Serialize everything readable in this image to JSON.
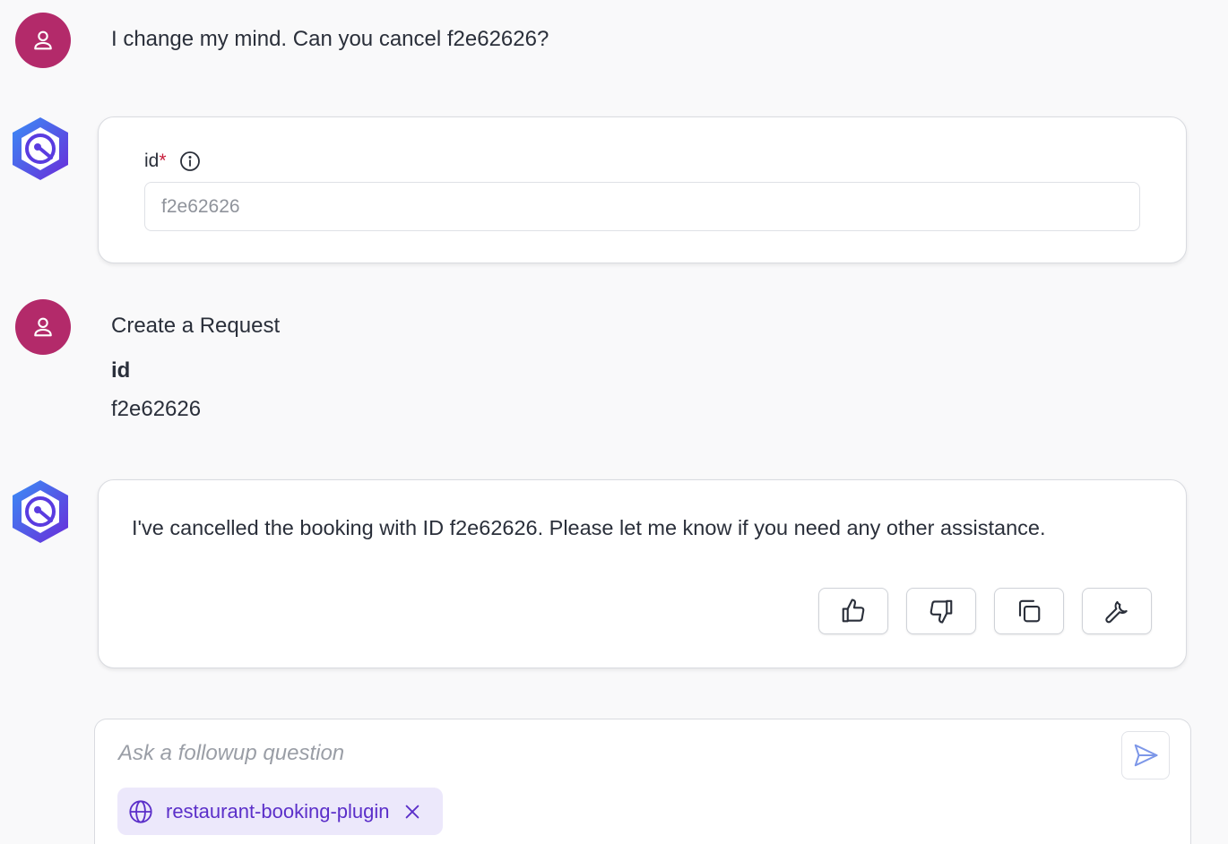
{
  "messages": [
    {
      "role": "user",
      "text": "I change my mind. Can you cancel f2e62626?"
    },
    {
      "role": "assistant",
      "form": {
        "field_label": "id",
        "required_mark": "*",
        "field_value": "f2e62626"
      }
    },
    {
      "role": "user",
      "title": "Create a Request",
      "param_name": "id",
      "param_value": "f2e62626"
    },
    {
      "role": "assistant",
      "text": "I've cancelled the booking with ID f2e62626. Please let me know if you need any other assistance.",
      "actions": [
        "thumbs-up-icon",
        "thumbs-down-icon",
        "copy-icon",
        "wrench-icon"
      ]
    }
  ],
  "composer": {
    "placeholder": "Ask a followup question",
    "plugin_chip": {
      "label": "restaurant-booking-plugin",
      "icon": "globe-icon"
    }
  },
  "colors": {
    "user_avatar": "#b32a6a",
    "bot_gradient_start": "#3a8ef6",
    "bot_gradient_end": "#6a2bd9",
    "chip_bg": "#ece8fb",
    "chip_text": "#5b2fc9",
    "required": "#c81e3c"
  }
}
